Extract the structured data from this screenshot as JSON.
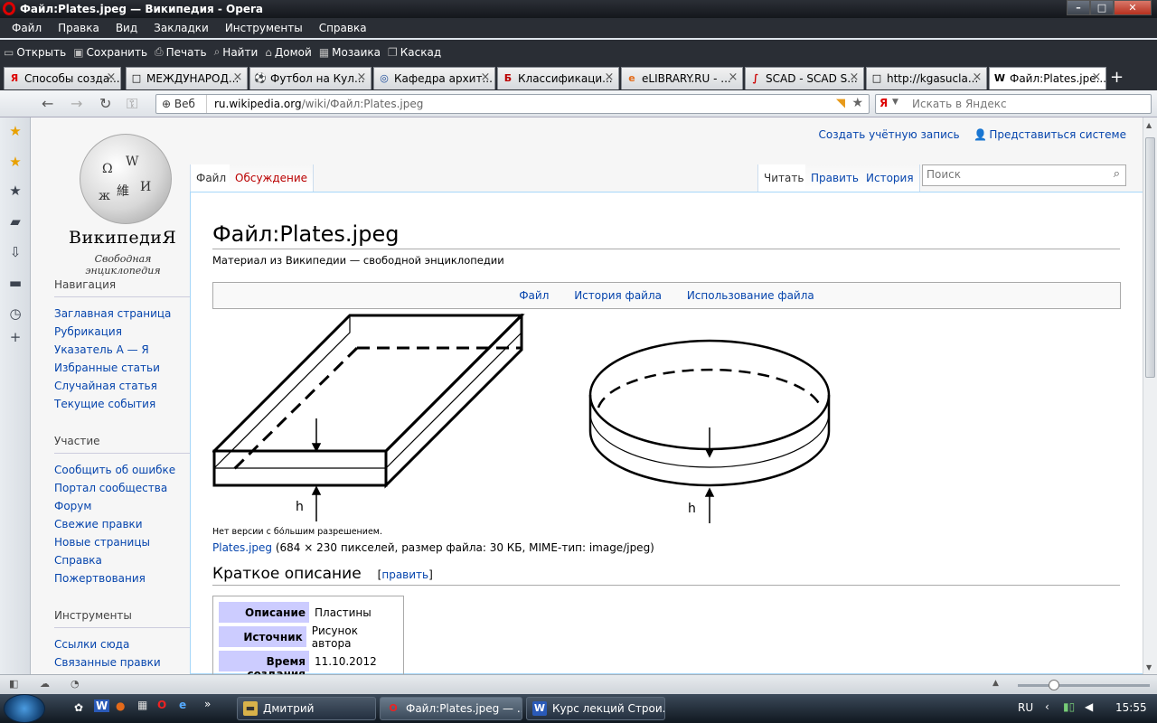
{
  "window": {
    "title": "Файл:Plates.jpeg — Википедия - Opera"
  },
  "menu": [
    "Файл",
    "Правка",
    "Вид",
    "Закладки",
    "Инструменты",
    "Справка"
  ],
  "toolbar": [
    {
      "label": "Открыть",
      "icon": "folder-icon"
    },
    {
      "label": "Сохранить",
      "icon": "disk-icon"
    },
    {
      "label": "Печать",
      "icon": "printer-icon"
    },
    {
      "label": "Найти",
      "icon": "magnifier-icon"
    },
    {
      "label": "Домой",
      "icon": "home-icon"
    },
    {
      "label": "Мозаика",
      "icon": "tile-icon"
    },
    {
      "label": "Каскад",
      "icon": "cascade-icon"
    }
  ],
  "tabs": [
    {
      "label": "Способы созда...",
      "fav": "Я",
      "favcolor": "#d00"
    },
    {
      "label": "МЕЖДУНАРОД...",
      "fav": "□",
      "favcolor": "#555"
    },
    {
      "label": "Футбол на Кул...",
      "fav": "⚽",
      "favcolor": "#2a7a2a"
    },
    {
      "label": "Кафедра архит...",
      "fav": "◎",
      "favcolor": "#1a4a9a"
    },
    {
      "label": "Классификаци...",
      "fav": "Б",
      "favcolor": "#b00"
    },
    {
      "label": "eLIBRARY.RU - ...",
      "fav": "e",
      "favcolor": "#e36b1a"
    },
    {
      "label": "SCAD - SCAD S...",
      "fav": "∫",
      "favcolor": "#c00"
    },
    {
      "label": "http://kgasucla...",
      "fav": "□",
      "favcolor": "#555"
    },
    {
      "label": "Файл:Plates.jpe...",
      "fav": "W",
      "favcolor": "#000"
    }
  ],
  "address": {
    "web_label": "Веб",
    "url_host": "ru.wikipedia.org",
    "url_path": "/wiki/Файл:Plates.jpeg",
    "search_placeholder": "Искать в Яндекс",
    "search_logo": "Я"
  },
  "wiki": {
    "wordmark": "ВикипедиЯ",
    "tagline": "Свободная энциклопедия",
    "create_account": "Создать учётную запись",
    "login": "Представиться системе",
    "tab_file": "Файл",
    "tab_talk": "Обсуждение",
    "tab_read": "Читать",
    "tab_edit": "Править",
    "tab_history": "История",
    "search_placeholder": "Поиск",
    "nav_heading": "Навигация",
    "nav": [
      "Заглавная страница",
      "Рубрикация",
      "Указатель А — Я",
      "Избранные статьи",
      "Случайная статья",
      "Текущие события"
    ],
    "part_heading": "Участие",
    "part": [
      "Сообщить об ошибке",
      "Портал сообщества",
      "Форум",
      "Свежие правки",
      "Новые страницы",
      "Справка",
      "Пожертвования"
    ],
    "tools_heading": "Инструменты",
    "tools": [
      "Ссылки сюда",
      "Связанные правки"
    ],
    "title": "Файл:Plates.jpeg",
    "subtitle": "Материал из Википедии — свободной энциклопедии",
    "filenav": [
      "Файл",
      "История файла",
      "Использование файла"
    ],
    "label_h": "h",
    "no_higher": "Нет версии с бо́льшим разрешением.",
    "file_link": "Plates.jpeg",
    "file_info": " (684 × 230 пикселей, размер файла: 30 КБ, MIME-тип: image/jpeg)",
    "section": "Краткое описание",
    "edit_open": "[",
    "edit_label": "править",
    "edit_close": "]",
    "info": [
      {
        "k": "Описание",
        "v": "Пластины"
      },
      {
        "k": "Источник",
        "v": "Рисунок автора"
      },
      {
        "k": "Время создания",
        "v": "11.10.2012"
      }
    ]
  },
  "taskbar": {
    "items": [
      {
        "label": "Дмитрий",
        "icon": "folder-icon"
      },
      {
        "label": "Файл:Plates.jpeg — ...",
        "icon": "opera-icon"
      },
      {
        "label": "Курс лекций Строи...",
        "icon": "word-icon"
      }
    ],
    "lang": "RU",
    "clock": "15:55"
  }
}
